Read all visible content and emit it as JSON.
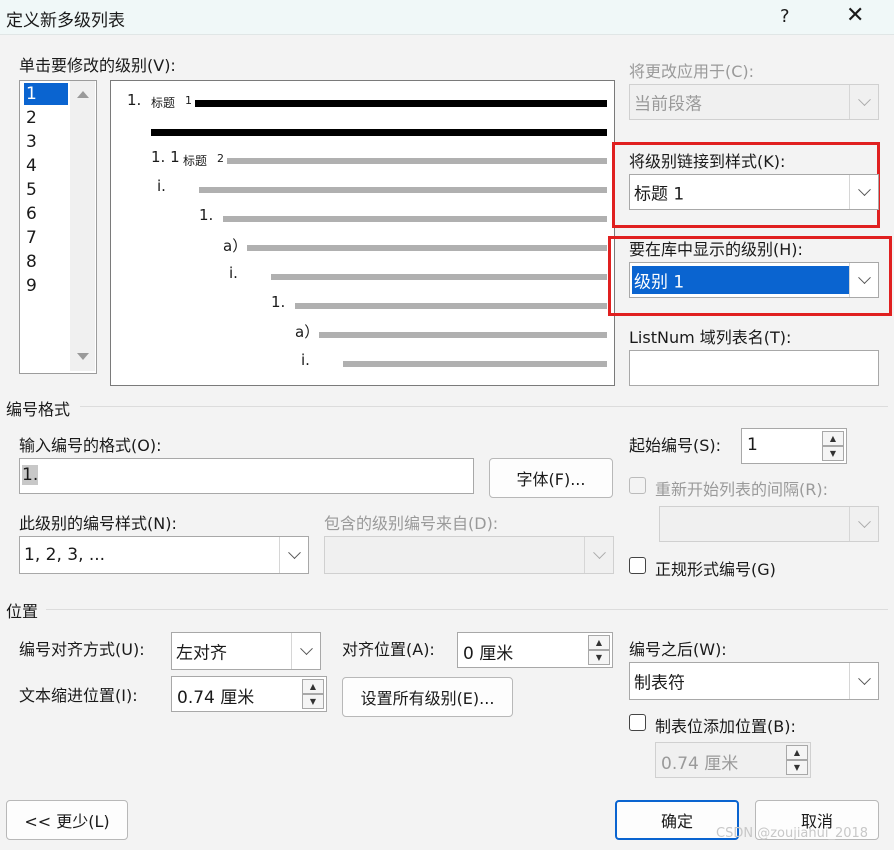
{
  "window": {
    "title": "定义新多级列表",
    "help": "?",
    "close": "✕"
  },
  "levels": {
    "label": "单击要修改的级别(V):",
    "items": [
      "1",
      "2",
      "3",
      "4",
      "5",
      "6",
      "7",
      "8",
      "9"
    ],
    "selected": "1"
  },
  "preview": {
    "lines": [
      "1.",
      "标题",
      "1",
      "1. 1",
      "标题",
      "2",
      "i.",
      "1.",
      "a）",
      "i.",
      "1.",
      "a）",
      "i."
    ]
  },
  "apply_to": {
    "label": "将更改应用于(C):",
    "value": "当前段落"
  },
  "link_style": {
    "label": "将级别链接到样式(K):",
    "value": "标题 1"
  },
  "gallery_level": {
    "label": "要在库中显示的级别(H):",
    "value": "级别 1"
  },
  "listnum": {
    "label": "ListNum 域列表名(T):",
    "value": ""
  },
  "number_format": {
    "section": "编号格式",
    "format_label": "输入编号的格式(O):",
    "format_value": "1.",
    "font_button": "字体(F)...",
    "style_label": "此级别的编号样式(N):",
    "style_value": "1, 2, 3, ...",
    "include_label": "包含的级别编号来自(D):",
    "include_value": "",
    "start_label": "起始编号(S):",
    "start_value": "1",
    "restart_label": "重新开始列表的间隔(R):",
    "restart_value": "",
    "legal_label": "正规形式编号(G)"
  },
  "position": {
    "section": "位置",
    "align_label": "编号对齐方式(U):",
    "align_value": "左对齐",
    "align_at_label": "对齐位置(A):",
    "align_at_value": "0 厘米",
    "indent_label": "文本缩进位置(I):",
    "indent_value": "0.74 厘米",
    "set_all_button": "设置所有级别(E)...",
    "follow_label": "编号之后(W):",
    "follow_value": "制表符",
    "tab_label": "制表位添加位置(B):",
    "tab_value": "0.74 厘米"
  },
  "footer": {
    "less_button": "<< 更少(L)",
    "ok_button": "确定",
    "cancel_button": "取消"
  },
  "watermark": "CSDN @zoujiahui_2018",
  "colors": {
    "selection": "#0a64d0",
    "highlight_box": "#e02020"
  }
}
